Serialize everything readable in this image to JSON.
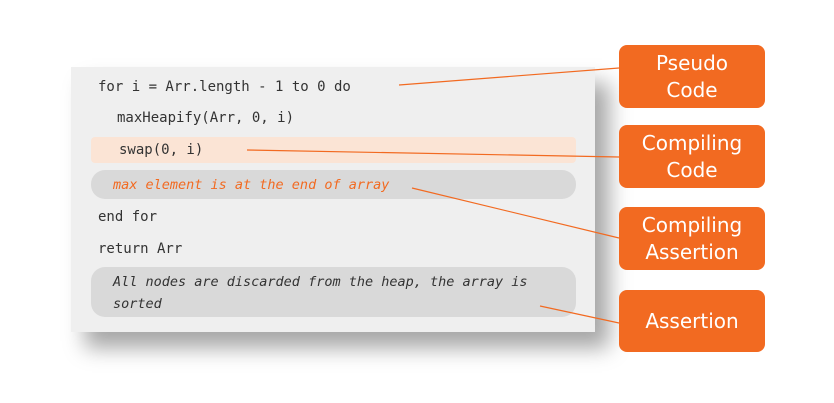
{
  "code_lines": {
    "loop_header": "for i = Arr.length - 1 to 0 do",
    "max_heapify": "maxHeapify(Arr, 0, i)",
    "swap": "swap(0, i)",
    "loop_assertion": "max element is at the end of array",
    "end_for": "end for",
    "return_stmt": "return Arr",
    "final_assertion": "All nodes are discarded from the heap, the array is sorted"
  },
  "callouts": {
    "pseudo_code": [
      "Pseudo",
      "Code"
    ],
    "compiling_code": [
      "Compiling",
      "Code"
    ],
    "compiling_assertion": [
      "Compiling",
      "Assertion"
    ],
    "assertion": [
      "Assertion"
    ]
  },
  "colors": {
    "accent": "#f26a21",
    "compiling_highlight": "#fbe4d5",
    "assertion_highlight": "#d9d9d9",
    "panel": "#efefef"
  }
}
